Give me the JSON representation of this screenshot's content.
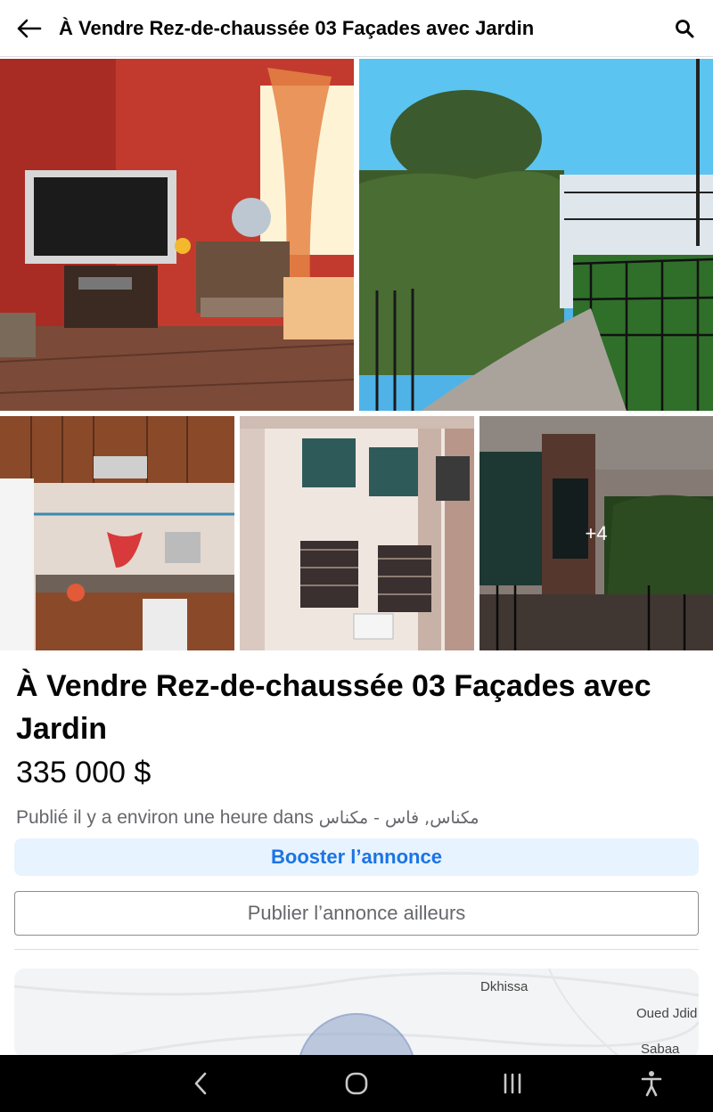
{
  "header": {
    "title": "À Vendre Rez-de-chaussée 03 Façades avec Jardin",
    "back_icon": "arrow-left-icon",
    "search_icon": "search-icon"
  },
  "gallery": {
    "photos": [
      {
        "subject": "living room with TV"
      },
      {
        "subject": "garden with hedge and fence"
      },
      {
        "subject": "kitchen"
      },
      {
        "subject": "building facade with windows"
      },
      {
        "subject": "entrance with gate"
      }
    ],
    "more_count": "+4"
  },
  "listing": {
    "title": "À Vendre Rez-de-chaussée 03 Façades avec Jardin",
    "price": "335 000 $",
    "published_prefix": "Publié il y a environ une heure dans",
    "published_location": "مكناس, فاس - مكناس"
  },
  "actions": {
    "boost_label": "Booster l’annonce",
    "publish_elsewhere_label": "Publier l’annonce ailleurs"
  },
  "map": {
    "labels": [
      "Dkhissa",
      "Oued Jdid",
      "Sabaa"
    ]
  },
  "system_nav": {
    "icons": [
      "back-icon",
      "home-icon",
      "recents-icon",
      "accessibility-icon"
    ]
  },
  "colors": {
    "accent": "#1b74e4",
    "boost_bg": "#e7f3ff",
    "secondary_text": "#65676b"
  }
}
